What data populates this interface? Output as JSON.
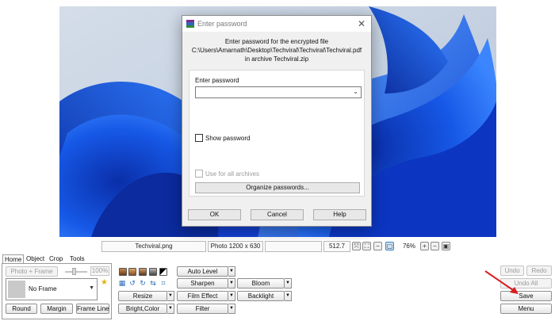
{
  "dialog": {
    "title": "Enter password",
    "message_line1": "Enter password for the encrypted file",
    "message_line2": "C:\\Users\\Amarnath\\Desktop\\Techviral\\Techviral\\Techviral.pdf",
    "message_line3": "in archive Techviral.zip",
    "password_label": "Enter password",
    "password_value": "",
    "show_password_label": "Show password",
    "use_all_label": "Use for all archives",
    "organize_label": "Organize passwords...",
    "ok_label": "OK",
    "cancel_label": "Cancel",
    "help_label": "Help"
  },
  "status": {
    "filename": "Techviral.png",
    "dimensions": "Photo 1200 x 630",
    "filesize": "512.7 KB",
    "zoom": "76%"
  },
  "toolbar": {
    "tabs": [
      "Home",
      "Object",
      "Crop",
      "Tools"
    ],
    "active_tab": "Home",
    "photo_frame_label": "Photo + Frame",
    "opacity_value": "100%",
    "frame_select": "No Frame",
    "round_label": "Round",
    "margin_label": "Margin",
    "frame_line_label": "Frame Line",
    "resize_label": "Resize",
    "bright_color_label": "Bright,Color",
    "auto_level_label": "Auto Level",
    "sharpen_label": "Sharpen",
    "film_effect_label": "Film Effect",
    "filter_label": "Filter",
    "bloom_label": "Bloom",
    "backlight_label": "Backlight",
    "undo_label": "Undo",
    "redo_label": "Redo",
    "undo_all_label": "Undo All",
    "save_label": "Save",
    "menu_label": "Menu"
  },
  "colors": {
    "accent": "#2c6fb4",
    "annotation_arrow": "#d81e1e"
  }
}
